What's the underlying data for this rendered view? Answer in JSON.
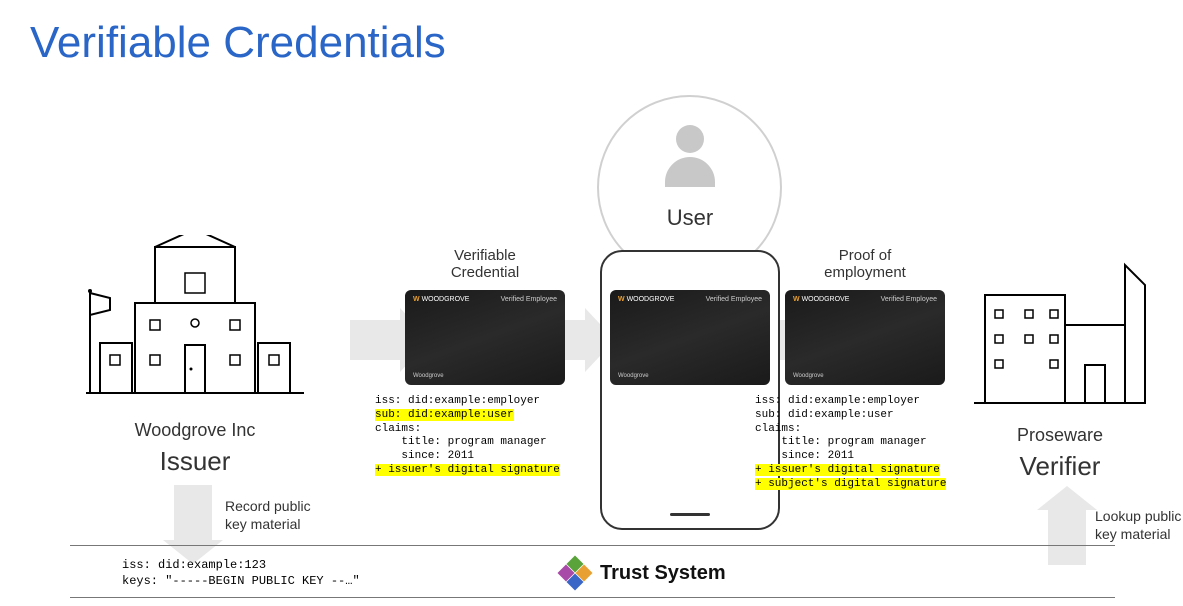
{
  "title": "Verifiable Credentials",
  "issuer": {
    "company": "Woodgrove Inc",
    "role": "Issuer"
  },
  "user_label": "User",
  "verifier": {
    "company": "Proseware",
    "role": "Verifier"
  },
  "credential_label": "Verifiable\nCredential",
  "proof_label": "Proof of\nemployment",
  "card": {
    "brand": "WOODGROVE",
    "verified": "Verified Employee",
    "company": "Woodgrove"
  },
  "code_issuer": {
    "line1": "iss: did:example:employer",
    "line2": "sub: did:example:user",
    "line3": "claims:",
    "line4": "    title: program manager",
    "line5": "    since: 2011",
    "line6": "+ issuer's digital signature"
  },
  "code_verifier": {
    "line1": "iss: did:example:employer",
    "line2": "sub: did:example:user",
    "line3": "claims:",
    "line4": "    title: program manager",
    "line5": "    since: 2011",
    "line6": "+ issuer's digital signature",
    "line7": "+ subject's digital signature"
  },
  "arrow_down_label": "Record public\nkey material",
  "arrow_up_label": "Lookup public\nkey material",
  "trust": {
    "label": "Trust System",
    "code": "iss: did:example:123\nkeys: \"-----BEGIN PUBLIC KEY --…\""
  }
}
